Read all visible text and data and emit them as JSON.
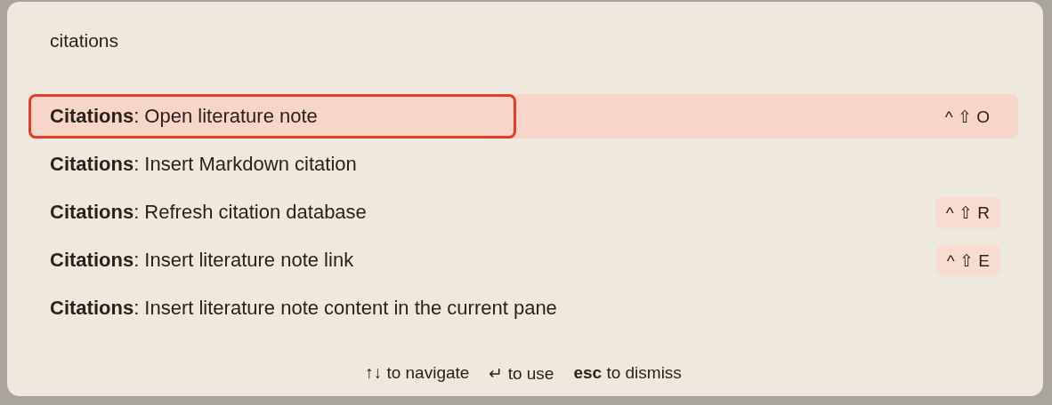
{
  "search": {
    "value": "citations"
  },
  "commands": [
    {
      "label": "**Citations**: Open literature note",
      "selected": true,
      "outlined": true,
      "hotkey": "^ ⇧ O"
    },
    {
      "label": "**Citations**: Insert Markdown citation",
      "selected": false,
      "outlined": false
    },
    {
      "label": "**Citations**: Refresh citation database",
      "selected": false,
      "outlined": false,
      "hotkey": "^ ⇧ R"
    },
    {
      "label": "**Citations**: Insert literature note link",
      "selected": false,
      "outlined": false,
      "hotkey": "^ ⇧ E"
    },
    {
      "label": "**Citations**: Insert literature note content in the current pane",
      "selected": false,
      "outlined": false
    }
  ],
  "instructions": [
    "↑↓ to navigate",
    "↵ to use",
    "**esc** to dismiss"
  ]
}
